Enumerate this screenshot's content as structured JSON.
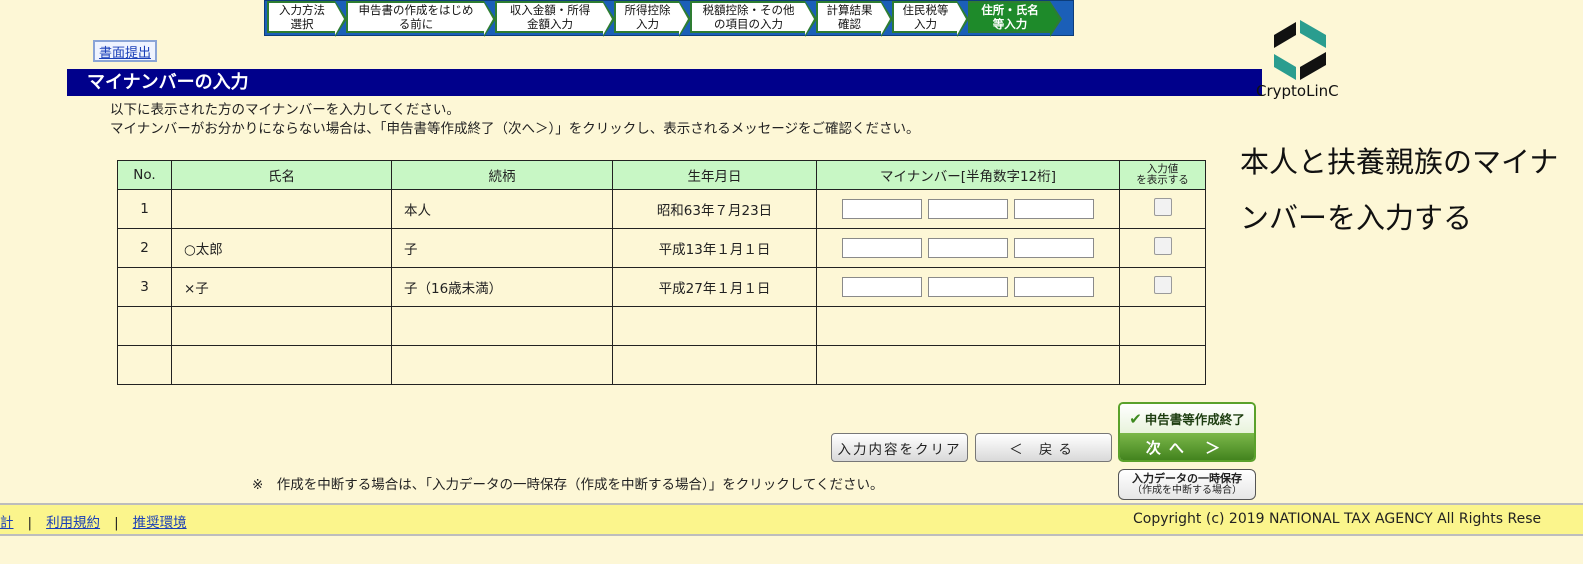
{
  "steps": [
    {
      "label": "入力方法\n選択"
    },
    {
      "label": "申告書の作成をはじめ\nる前に"
    },
    {
      "label": "収入金額・所得\n金額入力"
    },
    {
      "label": "所得控除\n入力"
    },
    {
      "label": "税額控除・その他\nの項目の入力"
    },
    {
      "label": "計算結果\n確認"
    },
    {
      "label": "住民税等\n入力"
    },
    {
      "label": "住所・氏名\n等入力"
    }
  ],
  "paper_submit": "書面提出",
  "page_title": "マイナンバーの入力",
  "intro": {
    "line1": "以下に表示された方のマイナンバーを入力してください。",
    "line2": "マイナンバーがお分かりにならない場合は、「申告書等作成終了（次へ＞）」をクリックし、表示されるメッセージをご確認ください。"
  },
  "table": {
    "headers": {
      "no": "No.",
      "name": "氏名",
      "relation": "続柄",
      "birth": "生年月日",
      "mynumber": "マイナンバー[半角数字12桁]",
      "show_line1": "入力値",
      "show_line2": "を表示する"
    },
    "rows": [
      {
        "no": "1",
        "name": "",
        "relation": "本人",
        "birth": "昭和63年７月23日"
      },
      {
        "no": "2",
        "name": "○太郎",
        "relation": "子",
        "birth": "平成13年１月１日"
      },
      {
        "no": "3",
        "name": "×子",
        "relation": "子（16歳未満）",
        "birth": "平成27年１月１日"
      }
    ]
  },
  "buttons": {
    "clear": "入力内容をクリア",
    "back": "＜ 戻る",
    "finish": "申告書等作成終了",
    "next": "次へ ＞",
    "save_line1": "入力データの一時保存",
    "save_line2": "（作成を中断する場合）"
  },
  "note": "※　作成を中断する場合は、「入力データの一時保存（作成を中断する場合）」をクリックしてください。",
  "footer": {
    "link1": "計",
    "link2": "利用規約",
    "link3": "推奨環境",
    "sep": "|",
    "copyright": "Copyright (c) 2019 NATIONAL TAX AGENCY All Rights Rese"
  },
  "logo": {
    "text": "CryptoLinC"
  },
  "side_caption": "本人と扶養親族のマイナンバーを入力する",
  "colors": {
    "title_bar": "#00008b",
    "header_cell": "#c8f7c5",
    "active_step": "#1e8a2a",
    "footer": "#fbf58c",
    "logo": "#2a9d8f"
  }
}
